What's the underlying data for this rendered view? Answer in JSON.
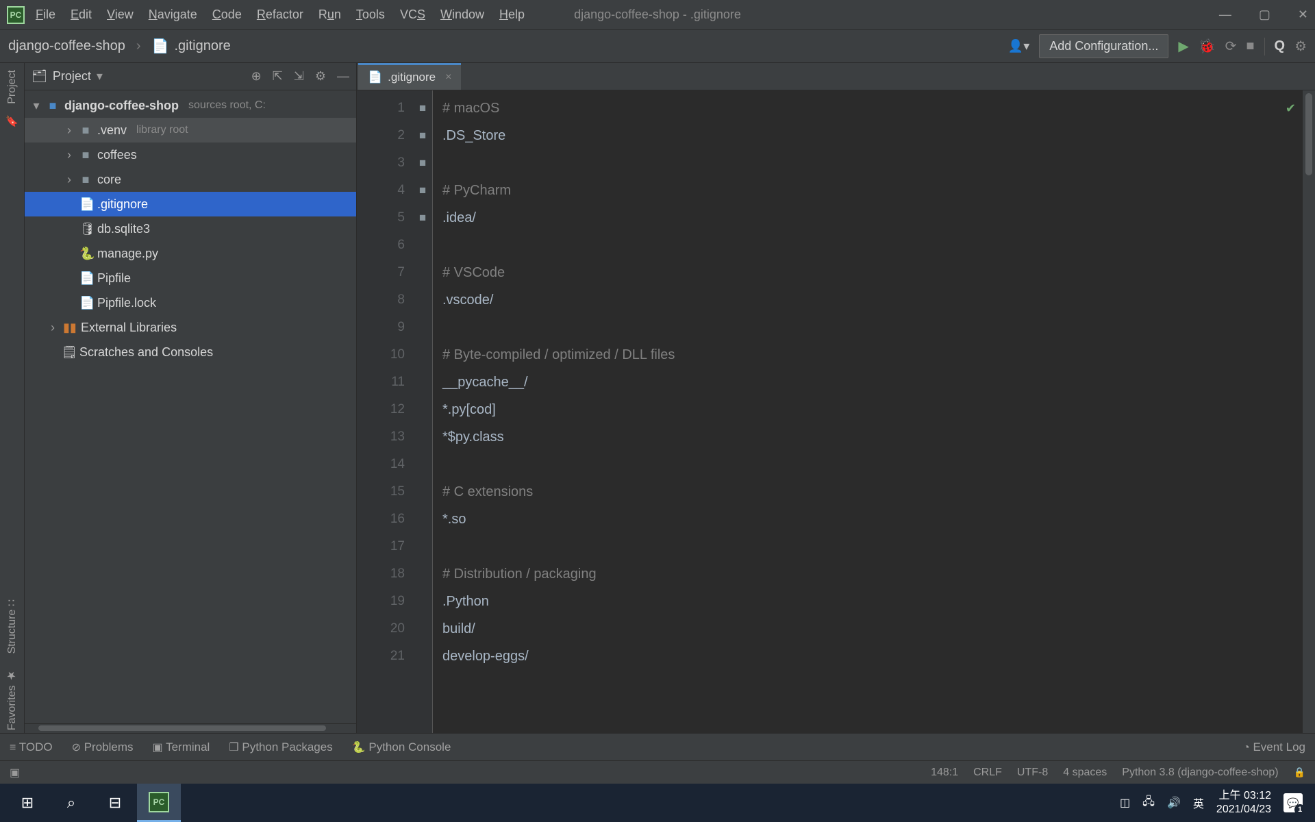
{
  "titlebar": {
    "menus": [
      "File",
      "Edit",
      "View",
      "Navigate",
      "Code",
      "Refactor",
      "Run",
      "Tools",
      "VCS",
      "Window",
      "Help"
    ],
    "window_title": "django-coffee-shop - .gitignore"
  },
  "toolbar": {
    "breadcrumb": [
      "django-coffee-shop",
      ".gitignore"
    ],
    "add_config": "Add Configuration..."
  },
  "sidebar": {
    "title": "Project",
    "tree": {
      "root": {
        "label": "django-coffee-shop",
        "hint": "sources root,  C:"
      },
      "items": [
        {
          "label": ".venv",
          "hint": "library root",
          "type": "folder",
          "arrow": true,
          "hl": true
        },
        {
          "label": "coffees",
          "type": "folder",
          "arrow": true
        },
        {
          "label": "core",
          "type": "folder",
          "arrow": true
        },
        {
          "label": ".gitignore",
          "type": "file",
          "selected": true
        },
        {
          "label": "db.sqlite3",
          "type": "file"
        },
        {
          "label": "manage.py",
          "type": "file"
        },
        {
          "label": "Pipfile",
          "type": "file"
        },
        {
          "label": "Pipfile.lock",
          "type": "file"
        }
      ],
      "ext_lib": "External Libraries",
      "scratches": "Scratches and Consoles"
    }
  },
  "editor": {
    "tab_name": ".gitignore",
    "lines": [
      {
        "n": 1,
        "t": "# macOS",
        "c": true
      },
      {
        "n": 2,
        "t": ".DS_Store"
      },
      {
        "n": 3,
        "t": ""
      },
      {
        "n": 4,
        "t": "# PyCharm",
        "c": true
      },
      {
        "n": 5,
        "t": ".idea/",
        "fold": true
      },
      {
        "n": 6,
        "t": ""
      },
      {
        "n": 7,
        "t": "# VSCode",
        "c": true
      },
      {
        "n": 8,
        "t": ".vscode/",
        "fold": true
      },
      {
        "n": 9,
        "t": ""
      },
      {
        "n": 10,
        "t": "# Byte-compiled / optimized / DLL files",
        "c": true
      },
      {
        "n": 11,
        "t": "__pycache__/",
        "fold": true
      },
      {
        "n": 12,
        "t": "*.py[cod]"
      },
      {
        "n": 13,
        "t": "*$py.class"
      },
      {
        "n": 14,
        "t": ""
      },
      {
        "n": 15,
        "t": "# C extensions",
        "c": true
      },
      {
        "n": 16,
        "t": "*.so"
      },
      {
        "n": 17,
        "t": ""
      },
      {
        "n": 18,
        "t": "# Distribution / packaging",
        "c": true
      },
      {
        "n": 19,
        "t": ".Python"
      },
      {
        "n": 20,
        "t": "build/",
        "fold": true
      },
      {
        "n": 21,
        "t": "develop-eggs/",
        "fold": true
      }
    ]
  },
  "bottombar": {
    "items": [
      "TODO",
      "Problems",
      "Terminal",
      "Python Packages",
      "Python Console"
    ],
    "event_log": "Event Log"
  },
  "status": {
    "pos": "148:1",
    "eol": "CRLF",
    "enc": "UTF-8",
    "indent": "4 spaces",
    "interp": "Python 3.8 (django-coffee-shop)"
  },
  "leftstrip": {
    "project": "Project",
    "structure": "Structure",
    "favorites": "Favorites"
  },
  "taskbar": {
    "ime": "英",
    "time": "上午 03:12",
    "date": "2021/04/23"
  }
}
